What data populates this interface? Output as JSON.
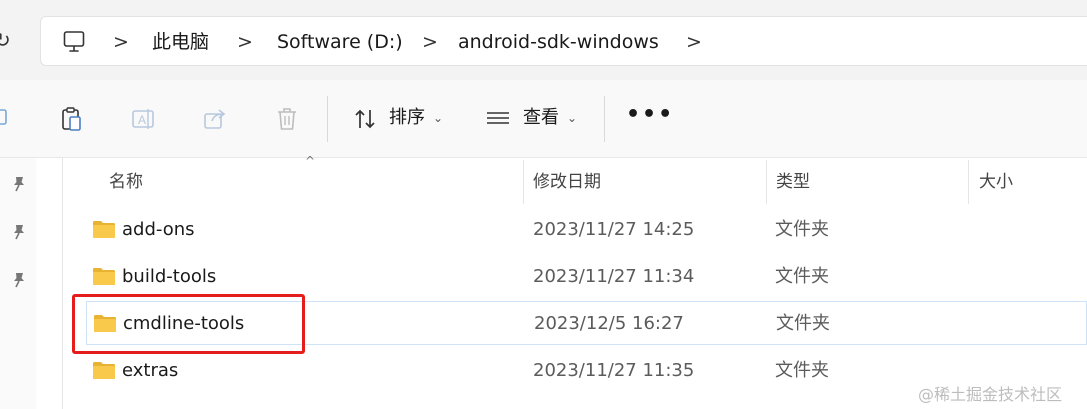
{
  "address_bar": {
    "crumbs": [
      "此电脑",
      "Software (D:)",
      "android-sdk-windows"
    ],
    "separator": ">"
  },
  "toolbar": {
    "sort_label": "排序",
    "view_label": "查看",
    "more_label": "•••"
  },
  "columns": {
    "name": "名称",
    "modified": "修改日期",
    "type": "类型",
    "size": "大小"
  },
  "files": [
    {
      "name": "add-ons",
      "modified": "2023/11/27 14:25",
      "type": "文件夹"
    },
    {
      "name": "build-tools",
      "modified": "2023/11/27 11:34",
      "type": "文件夹"
    },
    {
      "name": "cmdline-tools",
      "modified": "2023/12/5 16:27",
      "type": "文件夹"
    },
    {
      "name": "extras",
      "modified": "2023/11/27 11:35",
      "type": "文件夹"
    }
  ],
  "watermark": "@稀土掘金技术社区",
  "colors": {
    "highlight": "#e51c1c",
    "folder": "#f8c94a",
    "selection_border": "#cfe3f7"
  }
}
